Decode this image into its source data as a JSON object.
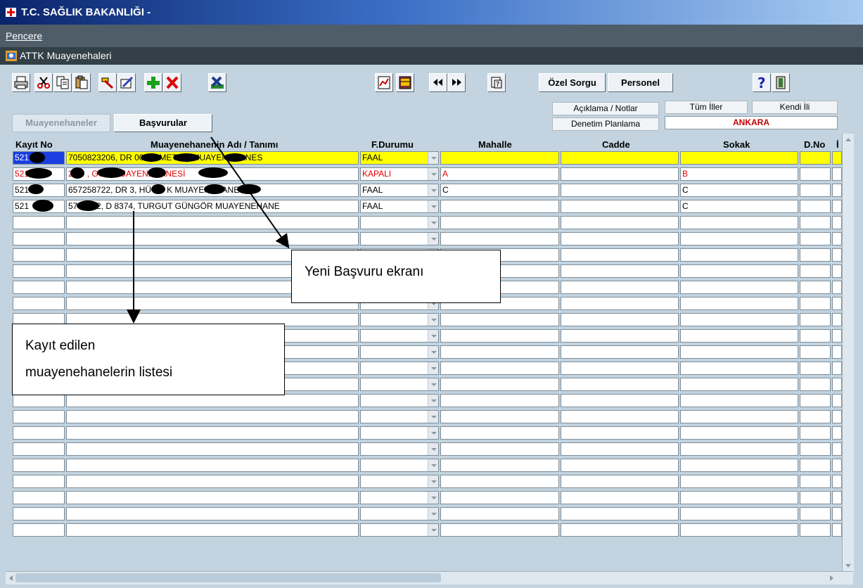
{
  "window": {
    "title": "T.C. SAĞLIK BAKANLIĞI -"
  },
  "menu": {
    "items": [
      "Pencere"
    ]
  },
  "form": {
    "title": "ATTK Muayenehaleri"
  },
  "toolbar": {
    "ozel_sorgu": "Özel Sorgu",
    "personel": "Personel",
    "icons": [
      "print-icon",
      "cut-icon",
      "copy-icon",
      "paste-icon",
      "edit-icon",
      "write-icon",
      "add-record-icon",
      "delete-record-icon",
      "excel-icon",
      "report-icon",
      "list-report-icon",
      "previous-icon",
      "next-icon",
      "query-icon",
      "help-icon",
      "exit-icon"
    ]
  },
  "buttons": {
    "aciklama": "Açıklama / Notlar",
    "denetim": "Denetim Planlama",
    "tum_iller": "Tüm İller",
    "kendi_ili": "Kendi İli"
  },
  "province": "ANKARA",
  "tabs": {
    "muayenehaneler": "Muayenehaneler",
    "basvurular": "Başvurular"
  },
  "columns": {
    "kayit_no": "Kayıt No",
    "adi": "Muayenehanenin Adı / Tanımı",
    "durum": "F.Durumu",
    "mahalle": "Mahalle",
    "cadde": "Cadde",
    "sokak": "Sokak",
    "dno": "D.No",
    "extra": "İ"
  },
  "rows": [
    {
      "kayit_no": "521",
      "adi": "7050823206, DR 008, HMET AŞ MUAYENEHANES",
      "durum": "FAAL",
      "mahalle": "",
      "cadde": "",
      "sokak": ""
    },
    {
      "kayit_no": "521",
      "adi": "2 30 , GÜN MUAYENEHANESİ",
      "durum": "KAPALI",
      "mahalle": "A",
      "cadde": "",
      "sokak": "B"
    },
    {
      "kayit_no": "521",
      "adi": "657258722, DR 3, HÜ LÜ K MUAYENEHANES",
      "durum": "FAAL",
      "mahalle": "C",
      "cadde": "",
      "sokak": "C"
    },
    {
      "kayit_no": "521",
      "adi": "57 60 82, D 8374, TURGUT GÜNGÖR MUAYENEHANE",
      "durum": "FAAL",
      "mahalle": "",
      "cadde": "",
      "sokak": "C"
    }
  ],
  "annotations": {
    "yeni_basvuru": "Yeni Başvuru ekranı",
    "kayit_line1": "Kayıt edilen",
    "kayit_line2": "muayenehanelerin listesi"
  }
}
